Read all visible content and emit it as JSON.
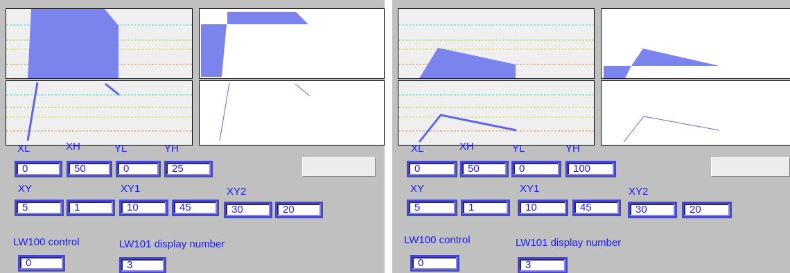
{
  "colors": {
    "panel_bg": "#c0c0c0",
    "fill": "#7b84ec",
    "stroke": "#5e66e6",
    "text": "#1a1aff",
    "grid_cyan": "#33dddd",
    "grid_green": "#99dd44",
    "grid_yellow": "#dddd33",
    "grid_orange": "#ee8844"
  },
  "panels": [
    {
      "labels": {
        "xl": "XL",
        "xh": "XH",
        "yl": "YL",
        "yh": "YH",
        "xy": "XY",
        "xy1": "XY1",
        "xy2": "XY2",
        "lw100": "LW100 control",
        "lw101": "LW101 display number"
      },
      "values": {
        "xl": "0",
        "xh": "50",
        "yl": "0",
        "yh": "25",
        "xy_x": "5",
        "xy_y": "1",
        "xy1_x": "10",
        "xy1_y": "45",
        "xy2_x": "30",
        "xy2_y": "20",
        "lw100": "0",
        "lw101": "3"
      },
      "chart_data": {
        "type": "area",
        "x_range": [
          0,
          50
        ],
        "y_range": [
          0,
          25
        ],
        "points": [
          {
            "x": 5,
            "y": 1
          },
          {
            "x": 10,
            "y": 45
          },
          {
            "x": 30,
            "y": 20
          }
        ],
        "variants": [
          "filled-area",
          "filled-area-crossing",
          "polyline-thick",
          "polyline-thin"
        ]
      }
    },
    {
      "labels": {
        "xl": "XL",
        "xh": "XH",
        "yl": "YL",
        "yh": "YH",
        "xy": "XY",
        "xy1": "XY1",
        "xy2": "XY2",
        "lw100": "LW100 control",
        "lw101": "LW101 display number"
      },
      "values": {
        "xl": "0",
        "xh": "50",
        "yl": "0",
        "yh": "100",
        "xy_x": "5",
        "xy_y": "1",
        "xy1_x": "10",
        "xy1_y": "45",
        "xy2_x": "30",
        "xy2_y": "20",
        "lw100": "0",
        "lw101": "3"
      },
      "chart_data": {
        "type": "area",
        "x_range": [
          0,
          50
        ],
        "y_range": [
          0,
          100
        ],
        "points": [
          {
            "x": 5,
            "y": 1
          },
          {
            "x": 10,
            "y": 45
          },
          {
            "x": 30,
            "y": 20
          }
        ],
        "variants": [
          "filled-area",
          "filled-area-crossing",
          "polyline-thick",
          "polyline-thin"
        ]
      }
    }
  ]
}
